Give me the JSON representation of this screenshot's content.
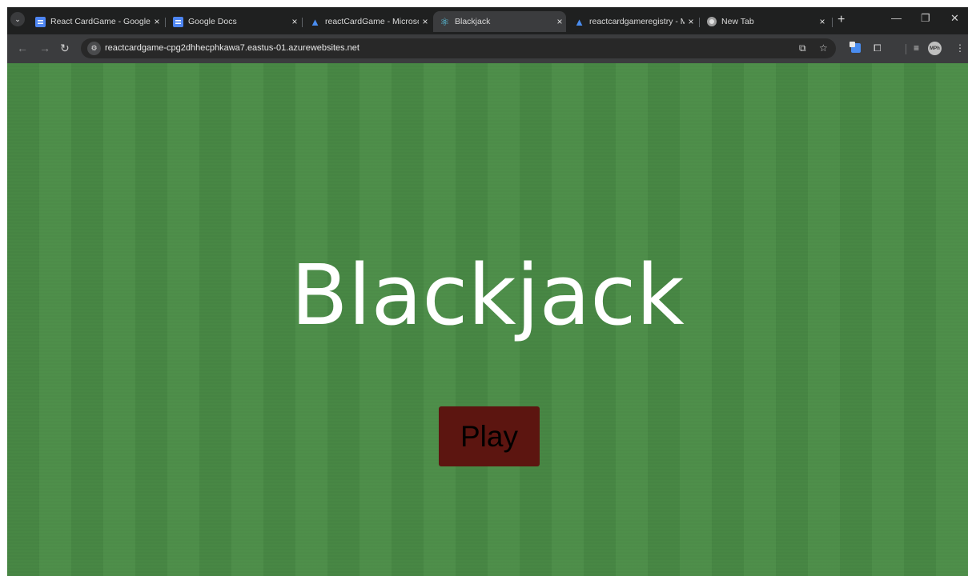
{
  "browser": {
    "tabs": [
      {
        "title": "React CardGame - Google",
        "icon": "google-docs-icon",
        "active": false
      },
      {
        "title": "Google Docs",
        "icon": "google-docs-icon",
        "active": false
      },
      {
        "title": "reactCardGame - Microsoft",
        "icon": "azure-icon",
        "active": false
      },
      {
        "title": "Blackjack",
        "icon": "react-icon",
        "active": true
      },
      {
        "title": "reactcardgameregistry - M",
        "icon": "azure-icon",
        "active": false
      },
      {
        "title": "New Tab",
        "icon": "chrome-icon",
        "active": false
      }
    ],
    "tab_close": "×",
    "new_tab": "+",
    "window_controls": {
      "minimize": "—",
      "restore": "❐",
      "close": "✕"
    },
    "nav": {
      "back": "←",
      "forward": "→",
      "reload": "↻"
    },
    "url": "reactcardgame-cpg2dhhecphkawa7.eastus-01.azurewebsites.net",
    "profile_label": "MPh",
    "colors": {
      "tab_bar": "#1f2020",
      "toolbar": "#3b3c3e",
      "omnibox": "#282828"
    }
  },
  "page": {
    "title": "Blackjack",
    "play_label": "Play",
    "colors": {
      "felt": "#4a8c46",
      "button": "#5c1510",
      "title_text": "#ffffff"
    }
  }
}
